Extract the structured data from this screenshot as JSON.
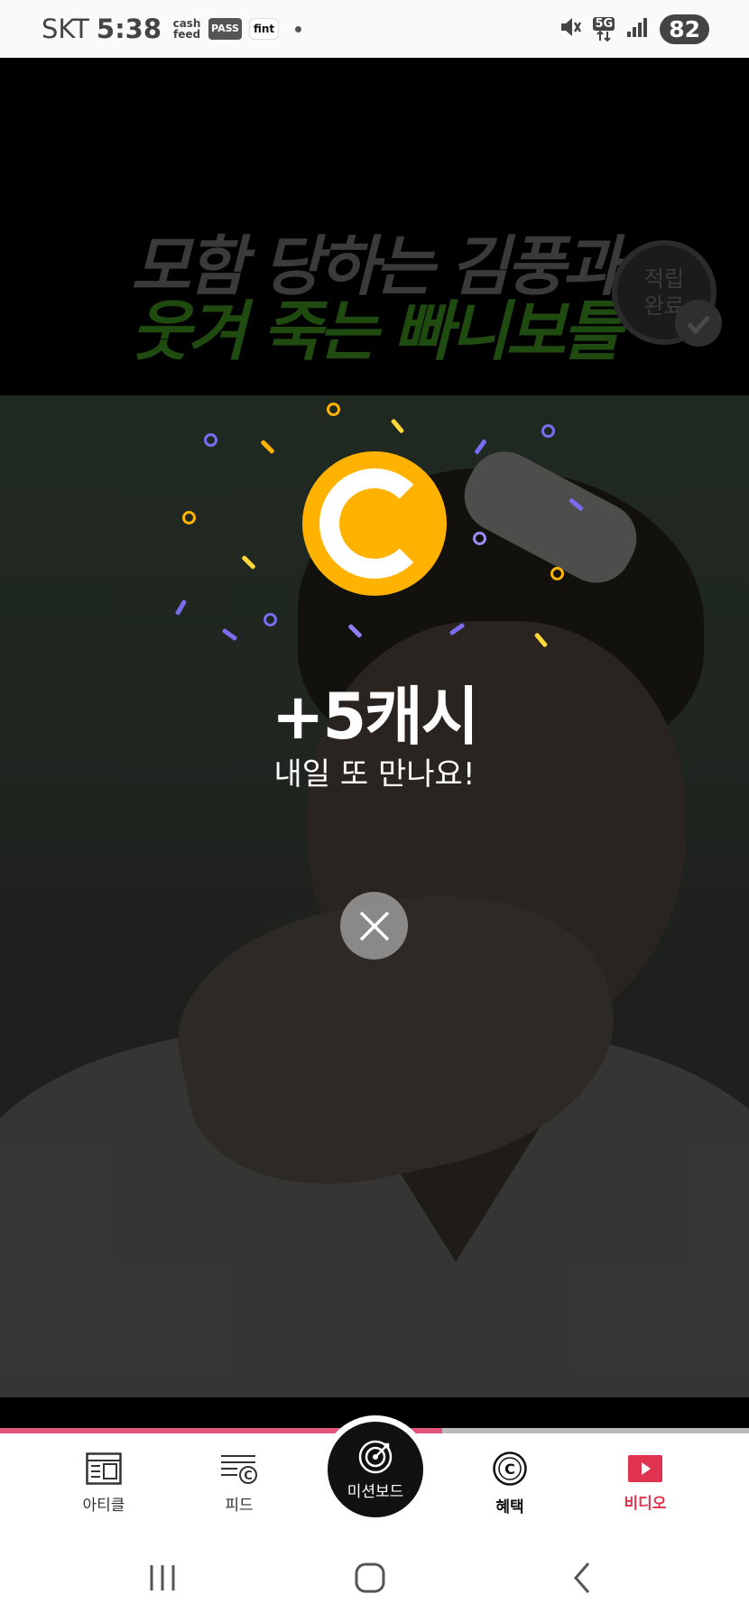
{
  "status_bar": {
    "carrier": "SKT",
    "time": "5:38",
    "app_chips": [
      "cash feed",
      "PASS",
      "fint"
    ],
    "network": "5G",
    "battery": "82"
  },
  "video": {
    "headline_line1": "모함 당하는 김풍과",
    "headline_line2": "웃겨 죽는 빠니보틀",
    "stamp_line1": "적립",
    "stamp_line2": "완료",
    "progress_fraction": 0.59
  },
  "reward": {
    "amount": "+5캐시",
    "subtitle": "내일 또 만나요!",
    "coin_color": "#ffb300"
  },
  "bottom_nav": {
    "items": [
      {
        "label": "아티클",
        "icon": "article-icon"
      },
      {
        "label": "피드",
        "icon": "feed-icon"
      },
      {
        "label": "미션보드",
        "icon": "target-icon"
      },
      {
        "label": "혜택",
        "icon": "coin-c-icon"
      },
      {
        "label": "비디오",
        "icon": "play-icon"
      }
    ],
    "active": "비디오",
    "accent_color": "#e0334f"
  },
  "system_nav": [
    "recent-apps-icon",
    "home-icon",
    "back-icon"
  ]
}
